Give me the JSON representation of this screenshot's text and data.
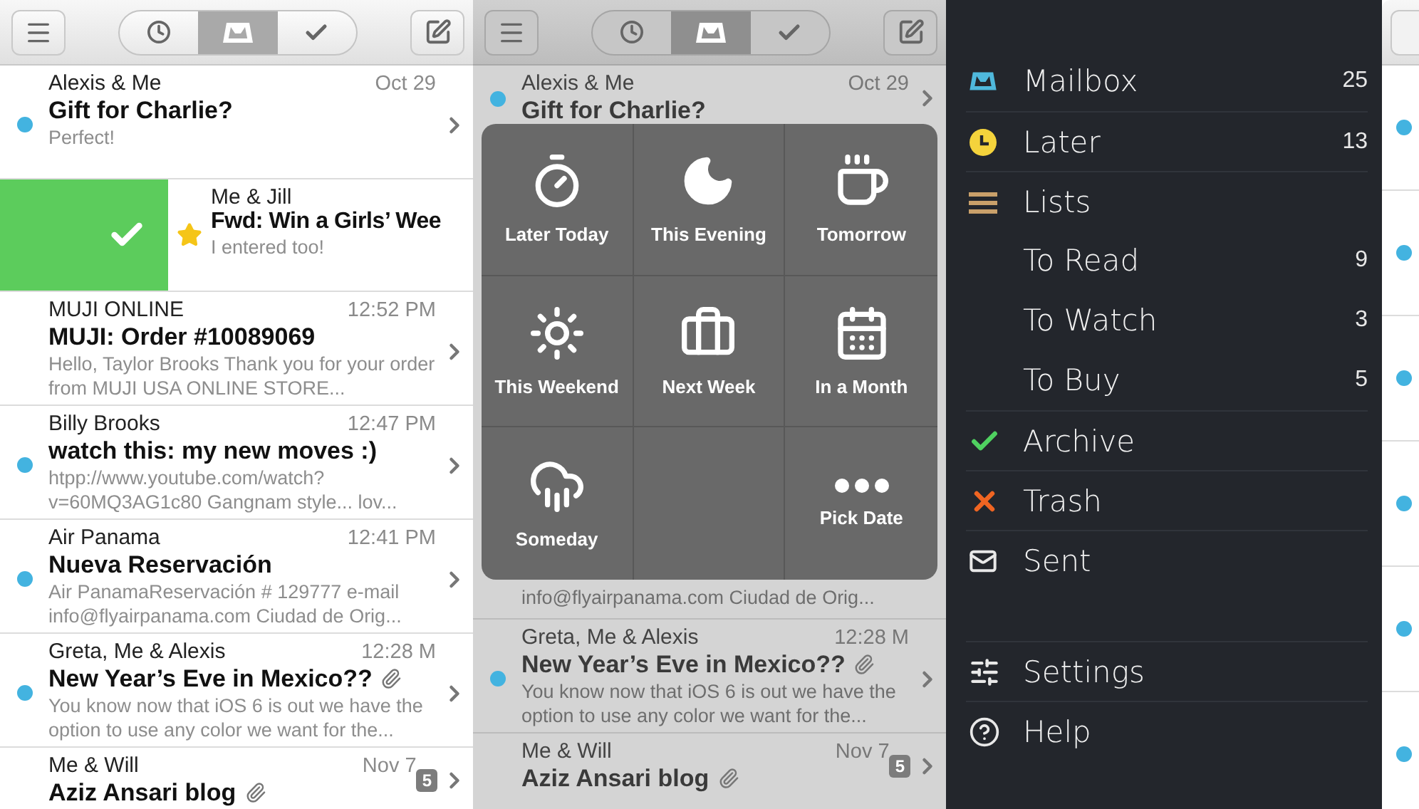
{
  "screens": [
    {
      "dimmed": false,
      "toolbar": {
        "segments": [
          {
            "kind": "later",
            "selected": false
          },
          {
            "kind": "inbox",
            "selected": true
          },
          {
            "kind": "archive",
            "selected": false
          }
        ]
      },
      "rows": [
        {
          "kind": "email",
          "sender": "Alexis & Me",
          "time": "Oct 29",
          "subject": "Gift for Charlie?",
          "preview": "Perfect!",
          "unread": true,
          "starred": false,
          "attachment": false
        },
        {
          "kind": "swiped",
          "sender": "Me & Jill",
          "subject": "Fwd: Win a Girls’ Wee",
          "preview": "I entered too!",
          "unread": false,
          "starred": true,
          "attachment": false
        },
        {
          "kind": "email",
          "sender": "MUJI ONLINE",
          "time": "12:52 PM",
          "subject": "MUJI: Order #10089069",
          "preview": "Hello, Taylor Brooks Thank you for your order from MUJI USA ONLINE STORE...",
          "unread": false,
          "starred": false,
          "attachment": false
        },
        {
          "kind": "email",
          "sender": "Billy Brooks",
          "time": "12:47 PM",
          "subject": "watch this: my new moves :)",
          "preview": "htpp://www.youtube.com/watch? v=60MQ3AG1c80 Gangnam style... lov...",
          "unread": true,
          "starred": false,
          "attachment": false
        },
        {
          "kind": "email",
          "sender": "Air Panama",
          "time": "12:41 PM",
          "subject": "Nueva Reservación",
          "preview": "Air PanamaReservación # 129777 e-mail info@flyairpanama.com Ciudad de Orig...",
          "unread": true,
          "starred": false,
          "attachment": false
        },
        {
          "kind": "email",
          "sender": "Greta, Me & Alexis",
          "time": "12:28 M",
          "subject": "New Year’s Eve in Mexico??",
          "preview": "You know now that iOS 6 is out we have the option to use any color we want for the...",
          "unread": true,
          "starred": false,
          "attachment": true
        },
        {
          "kind": "email",
          "sender": "Me & Will",
          "time": "Nov 7",
          "subject": "Aziz Ansari blog",
          "badge": "5",
          "unread": false,
          "starred": false,
          "attachment": true
        }
      ]
    },
    {
      "dimmed": true,
      "toolbar": {
        "segments": [
          {
            "kind": "later",
            "selected": false
          },
          {
            "kind": "inbox",
            "selected": true
          },
          {
            "kind": "archive",
            "selected": false
          }
        ]
      },
      "rows": [
        {
          "kind": "email",
          "sender": "Alexis & Me",
          "time": "Oct 29",
          "subject": "Gift for Charlie?",
          "unread": true,
          "starred": false,
          "attachment": false
        },
        {
          "kind": "snooze-picker",
          "options": [
            {
              "kind": "stopwatch",
              "label": "Later Today"
            },
            {
              "kind": "moon",
              "label": "This Evening"
            },
            {
              "kind": "cup",
              "label": "Tomorrow"
            },
            {
              "kind": "sun",
              "label": "This Weekend"
            },
            {
              "kind": "briefcase",
              "label": "Next Week"
            },
            {
              "kind": "calendar",
              "label": "In a Month"
            },
            {
              "kind": "cloud",
              "label": "Someday"
            },
            {
              "kind": "blank"
            },
            {
              "kind": "dots",
              "label": "Pick Date"
            }
          ]
        },
        {
          "kind": "preview-tail",
          "preview": "info@flyairpanama.com Ciudad de Orig..."
        },
        {
          "kind": "email",
          "sender": "Greta, Me & Alexis",
          "time": "12:28 M",
          "subject": "New Year’s Eve in Mexico??",
          "preview": "You know now that iOS 6 is out we have the option to use any color we want for the...",
          "unread": true,
          "starred": false,
          "attachment": true
        },
        {
          "kind": "email",
          "sender": "Me & Will",
          "time": "Nov 7",
          "subject": "Aziz Ansari blog",
          "badge": "5",
          "unread": false,
          "starred": false,
          "attachment": true
        }
      ]
    }
  ],
  "menu": {
    "items": [
      {
        "kind": "mailbox",
        "label": "Mailbox",
        "count": "25",
        "color": "#4fb8dc"
      },
      {
        "kind": "later",
        "label": "Later",
        "count": "13",
        "color": "#f4d33c"
      },
      {
        "kind": "lists",
        "label": "Lists",
        "color": "#c9a06a",
        "children": [
          {
            "label": "To Read",
            "count": "9"
          },
          {
            "label": "To Watch",
            "count": "3"
          },
          {
            "label": "To Buy",
            "count": "5"
          }
        ]
      },
      {
        "kind": "archive",
        "label": "Archive",
        "color": "#4fd160"
      },
      {
        "kind": "trash",
        "label": "Trash",
        "color": "#f06522"
      },
      {
        "kind": "sent",
        "label": "Sent",
        "color": "#e8e8e8"
      }
    ],
    "footer_items": [
      {
        "kind": "settings",
        "label": "Settings"
      },
      {
        "kind": "help",
        "label": "Help"
      }
    ]
  },
  "peek": {
    "rows": [
      {
        "unread": true
      },
      {
        "unread": true
      },
      {
        "unread": true
      },
      {
        "unread": true
      },
      {
        "unread": true
      },
      {
        "unread": true
      }
    ]
  }
}
